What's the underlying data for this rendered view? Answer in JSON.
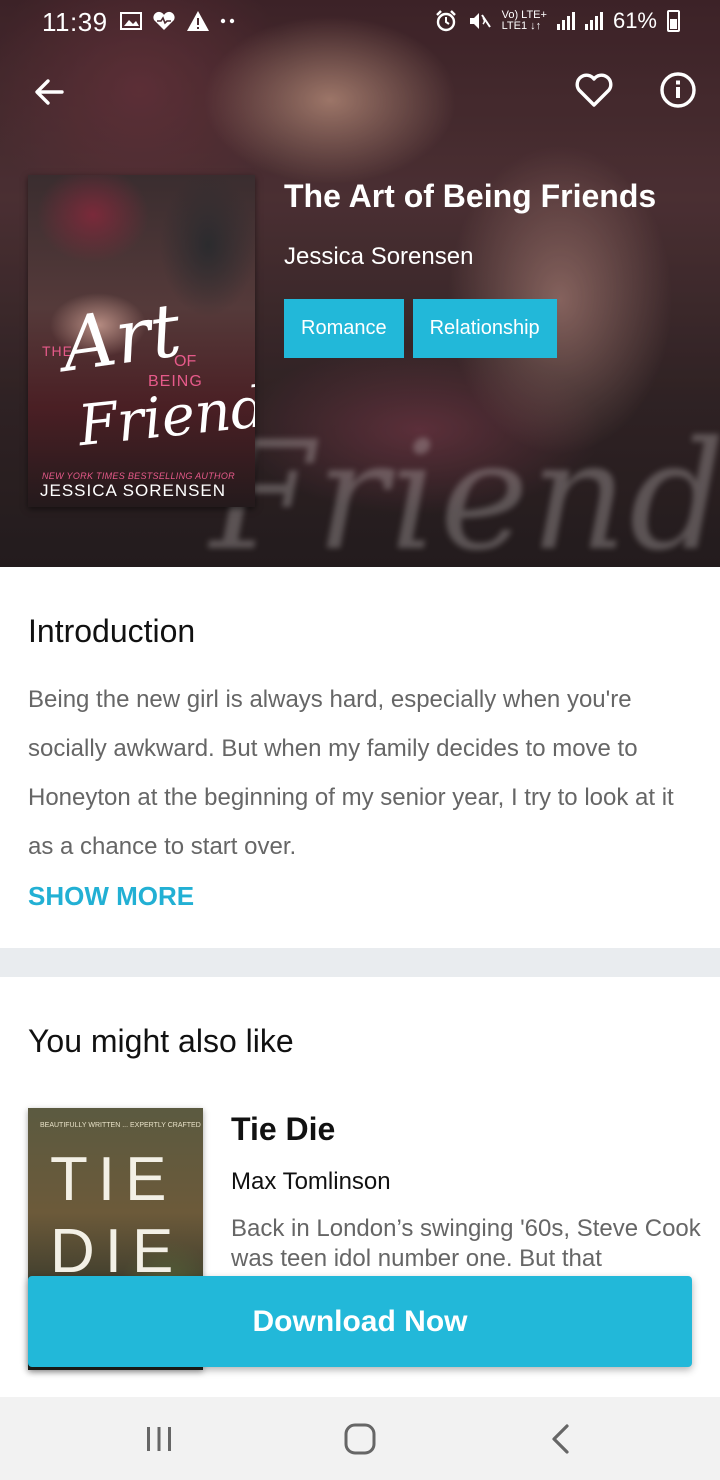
{
  "status_bar": {
    "time": "11:39",
    "network_top": "Vo) LTE+",
    "network_bottom": "LTE1 ↓↑",
    "battery": "61%"
  },
  "book": {
    "title": "The Art of Being Friends",
    "author": "Jessica Sorensen",
    "tags": [
      "Romance",
      "Relationship"
    ],
    "cover": {
      "the": "THE",
      "art": "Art",
      "of": "OF",
      "being": "BEING",
      "friends": "Friends",
      "nyt": "NEW YORK TIMES BESTSELLING AUTHOR",
      "author": "JESSICA SORENSEN"
    }
  },
  "introduction": {
    "heading": "Introduction",
    "text": "Being the new girl is always hard, especially when you're socially awkward. But when my family decides to move to Honeyton at the beginning of my senior year, I try to look at it as a chance to start over.",
    "show_more": "SHOW MORE"
  },
  "recommendations": {
    "heading": "You might also like",
    "items": [
      {
        "title": "Tie Die",
        "author": "Max Tomlinson",
        "description": "Back in London’s swinging '60s, Steve Cook was teen idol number one. But that",
        "cover": {
          "top": "BEAUTIFULLY WRITTEN ... EXPERTLY CRAFTED",
          "line1": "TIE",
          "line2": "DIE"
        }
      }
    ]
  },
  "download_button": "Download Now",
  "colors": {
    "accent": "#22b8d9",
    "link": "#22b0d4",
    "divider": "#e9ecef",
    "body_text": "#666666"
  },
  "icons": [
    "back-arrow-icon",
    "heart-icon",
    "info-icon",
    "recent-apps-icon",
    "home-icon",
    "nav-back-icon"
  ]
}
